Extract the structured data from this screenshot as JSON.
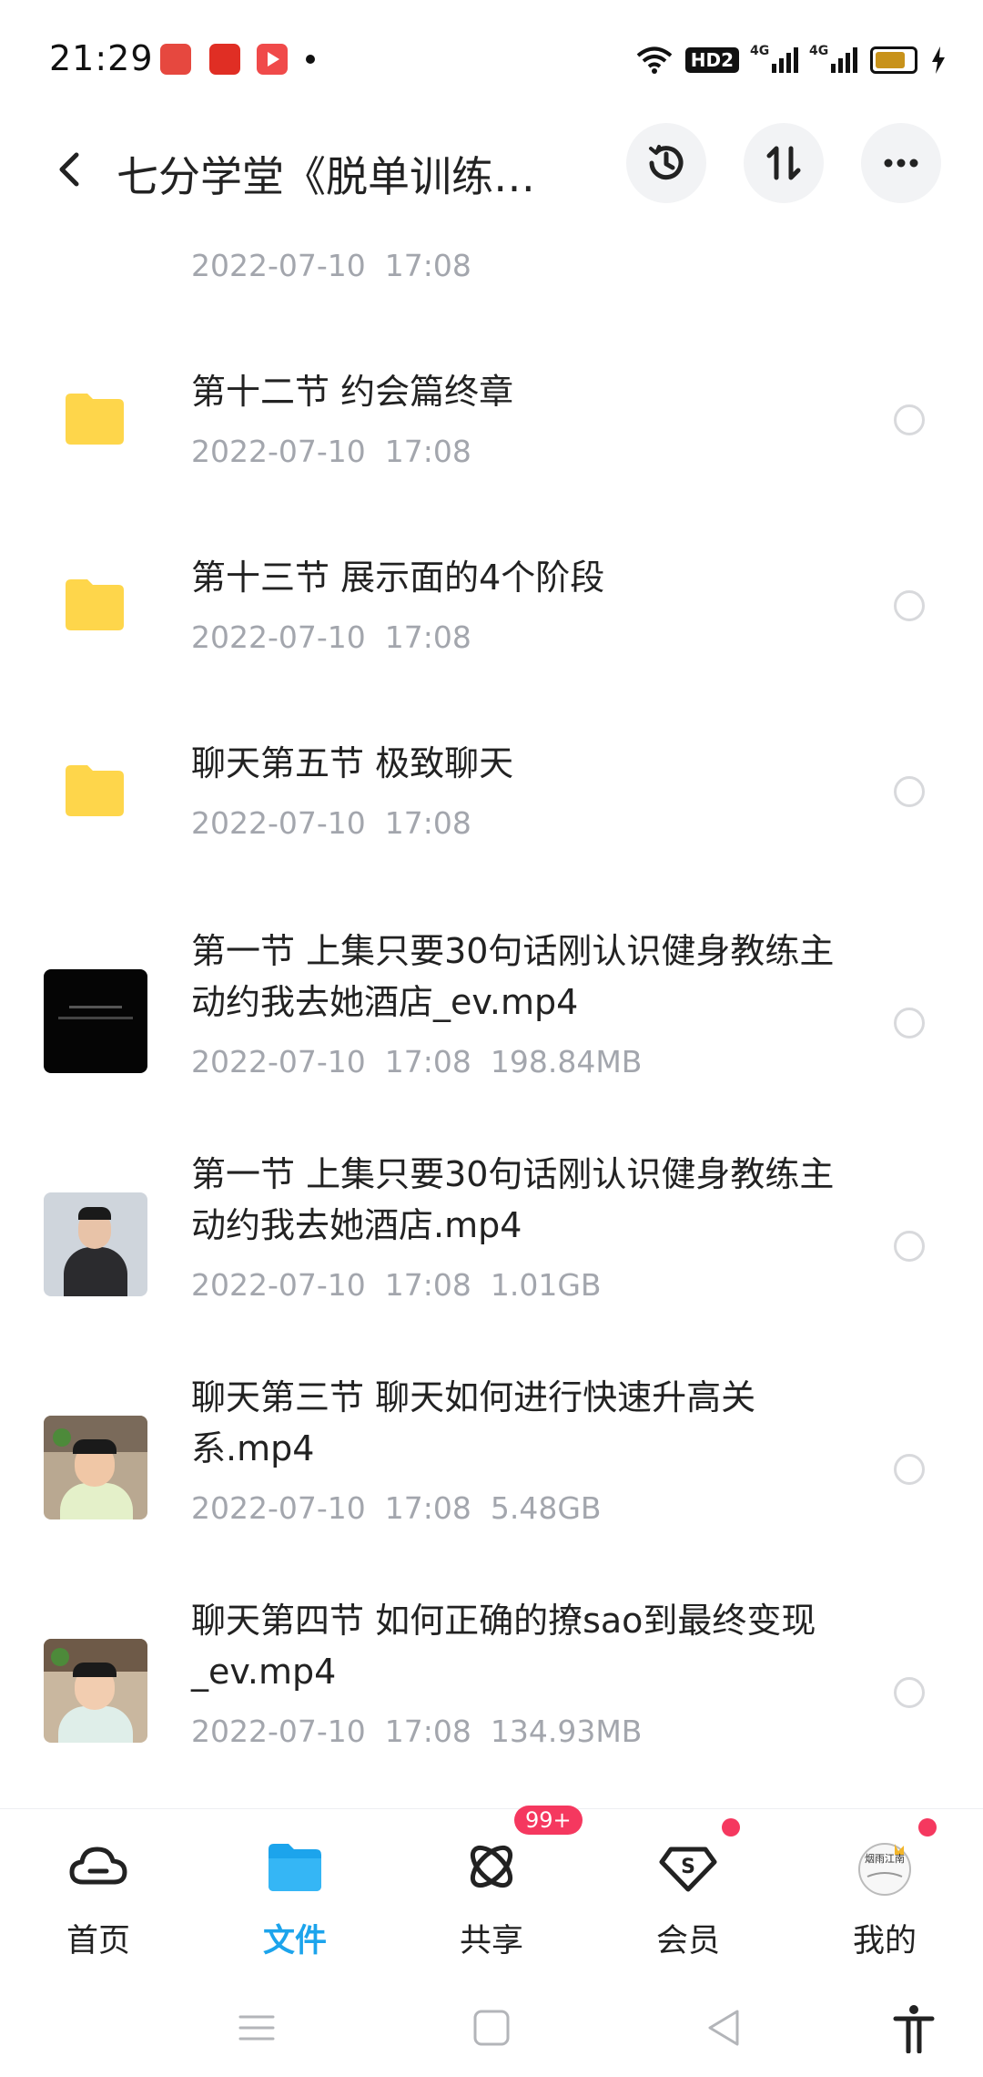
{
  "status_bar": {
    "time": "21:29",
    "network_badge": "HD2",
    "net_labels": [
      "4G",
      "4G"
    ],
    "icons": [
      "toutiao-icon",
      "pinduoduo-icon",
      "video-app-icon",
      "wifi-icon",
      "battery-icon",
      "charging-icon"
    ]
  },
  "header": {
    "title": "七分学堂《脱单训练…",
    "icons": [
      "back-icon",
      "history-icon",
      "sort-icon",
      "more-icon"
    ]
  },
  "files": [
    {
      "name": "",
      "date": "2022-07-10",
      "time": "17:08",
      "size": "",
      "kind": "folder"
    },
    {
      "name": "第十二节  约会篇终章",
      "date": "2022-07-10",
      "time": "17:08",
      "size": "",
      "kind": "folder"
    },
    {
      "name": "第十三节  展示面的4个阶段",
      "date": "2022-07-10",
      "time": "17:08",
      "size": "",
      "kind": "folder"
    },
    {
      "name": "聊天第五节  极致聊天",
      "date": "2022-07-10",
      "time": "17:08",
      "size": "",
      "kind": "folder"
    },
    {
      "name": "第一节 上集只要30句话刚认识健身教练主动约我去她酒店_ev.mp4",
      "date": "2022-07-10",
      "time": "17:08",
      "size": "198.84MB",
      "kind": "video"
    },
    {
      "name": "第一节 上集只要30句话刚认识健身教练主动约我去她酒店.mp4",
      "date": "2022-07-10",
      "time": "17:08",
      "size": "1.01GB",
      "kind": "video"
    },
    {
      "name": "聊天第三节 聊天如何进行快速升高关系.mp4",
      "date": "2022-07-10",
      "time": "17:08",
      "size": "5.48GB",
      "kind": "video"
    },
    {
      "name": "聊天第四节  如何正确的撩sao到最终变现_ev.mp4",
      "date": "2022-07-10",
      "time": "17:08",
      "size": "134.93MB",
      "kind": "video"
    }
  ],
  "tabs": [
    {
      "label": "首页",
      "icon": "cloud-icon"
    },
    {
      "label": "文件",
      "icon": "folder-icon"
    },
    {
      "label": "共享",
      "icon": "share-orbit-icon",
      "badge": "99+"
    },
    {
      "label": "会员",
      "icon": "vip-s-icon"
    },
    {
      "label": "我的",
      "icon": "avatar-icon",
      "avatar_text": "烟雨江南"
    }
  ],
  "nav_bar": {
    "icons": [
      "menu-icon",
      "home-square-icon",
      "back-triangle-icon",
      "accessibility-icon"
    ]
  },
  "colors": {
    "accent": "#1ca4ec",
    "folder": "#fed64b",
    "badge": "#f5385f",
    "meta": "#a3a6ad"
  }
}
